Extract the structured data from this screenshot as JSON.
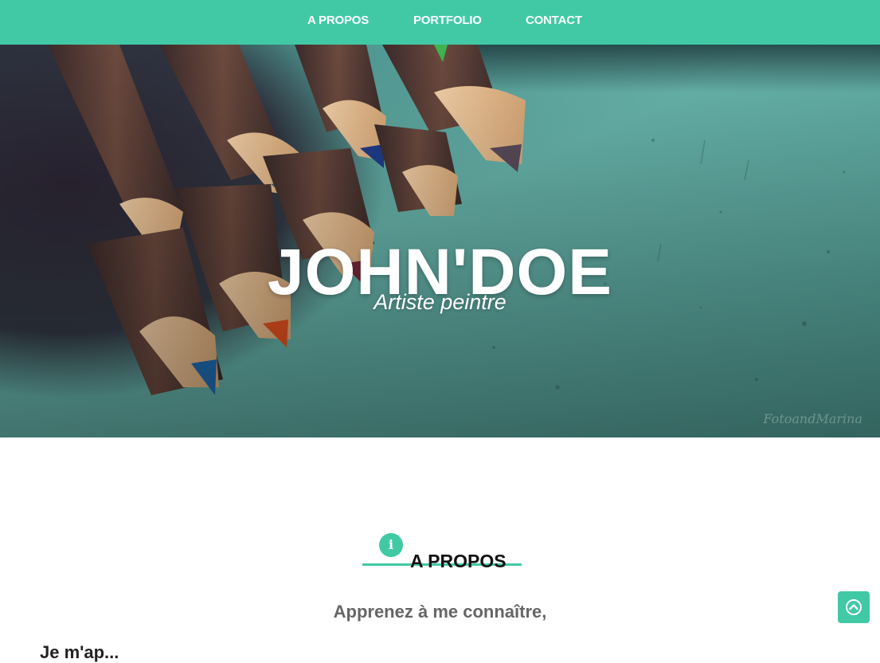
{
  "nav": {
    "items": [
      {
        "label": "A PROPOS"
      },
      {
        "label": "PORTFOLIO"
      },
      {
        "label": "CONTACT"
      }
    ]
  },
  "hero": {
    "title": "JOHN'DOE",
    "subtitle": "Artiste peintre",
    "background_image": "colored-pencils-photo",
    "watermark": "FotoandMarina"
  },
  "about": {
    "icon": "info-icon",
    "icon_glyph": "i",
    "title": "A PROPOS",
    "lead": "Apprenez à me connaître,",
    "partial_text": "Je m'ap..."
  },
  "back_to_top": {
    "icon": "chevron-up-icon"
  },
  "colors": {
    "accent": "#41c9a5",
    "hero_teal": "#5faaa2",
    "heading_text": "#111111",
    "lead_text": "#666666",
    "white": "#ffffff"
  }
}
